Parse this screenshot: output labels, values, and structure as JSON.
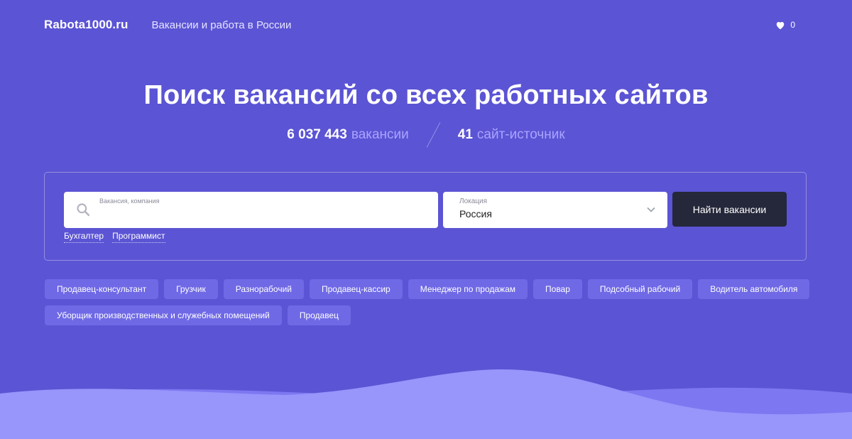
{
  "header": {
    "logo": "Rabota1000.ru",
    "tagline": "Вакансии и работа в России",
    "favorites_count": "0"
  },
  "hero": {
    "title": "Поиск вакансий со всех работных сайтов",
    "stats": [
      {
        "num": "6 037 443",
        "label": "вакансии"
      },
      {
        "num": "41",
        "label": "сайт-источник"
      }
    ]
  },
  "search": {
    "query_label": "Вакансия, компания",
    "query_value": "",
    "location_label": "Локация",
    "location_value": "Россия",
    "submit_label": "Найти вакансии",
    "quick_links": [
      "Бухгалтер",
      "Программист"
    ]
  },
  "popular": [
    "Продавец-консультант",
    "Грузчик",
    "Разнорабочий",
    "Продавец-кассир",
    "Менеджер по продажам",
    "Повар",
    "Подсобный рабочий",
    "Водитель автомобиля",
    "Уборщик производственных и служебных помещений",
    "Продавец"
  ],
  "colors": {
    "background": "#5b54d4",
    "button": "#25273a",
    "chip": "#6f69e6",
    "stat_label": "#a9a4ff",
    "wave_front": "#9895fb",
    "wave_back": "#7d77f1"
  }
}
